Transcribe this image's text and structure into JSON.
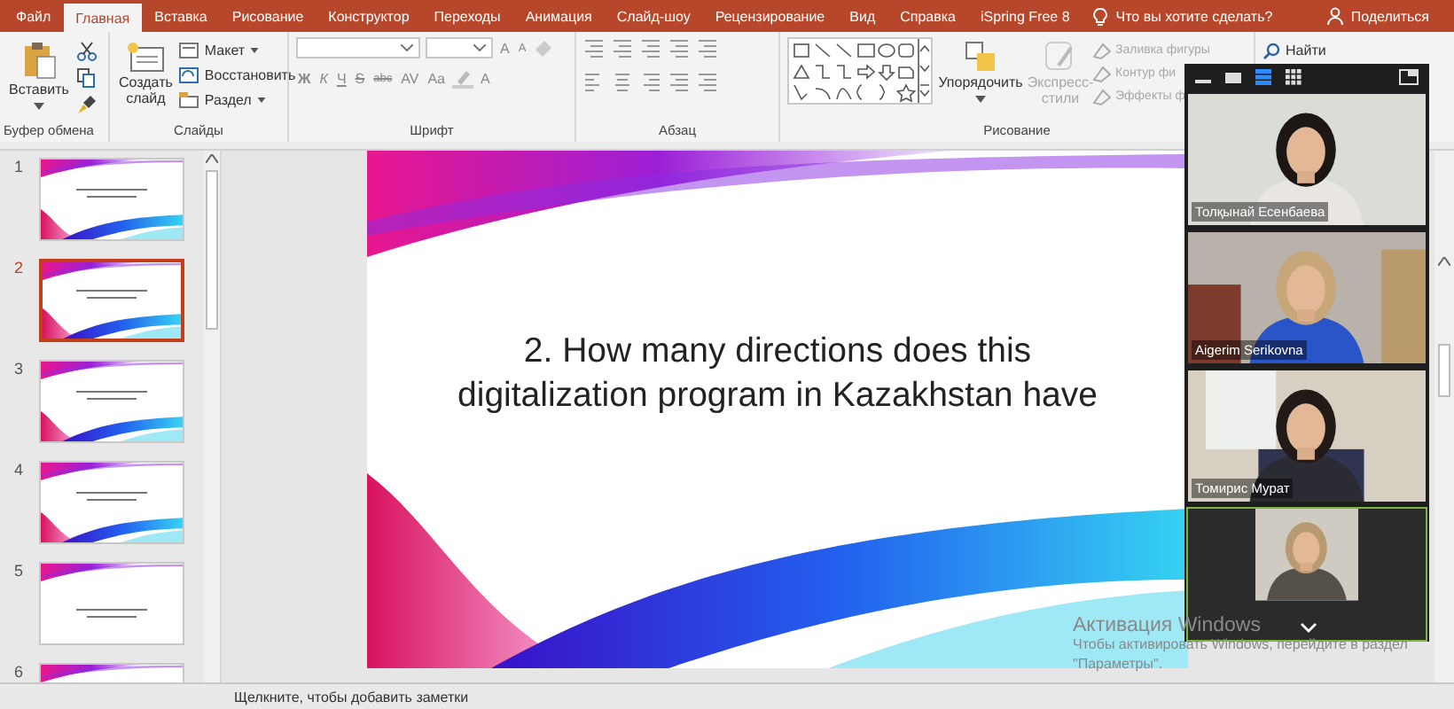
{
  "ribbon_tabs": [
    {
      "label": "Файл",
      "selected": false
    },
    {
      "label": "Главная",
      "selected": true
    },
    {
      "label": "Вставка",
      "selected": false
    },
    {
      "label": "Рисование",
      "selected": false
    },
    {
      "label": "Конструктор",
      "selected": false
    },
    {
      "label": "Переходы",
      "selected": false
    },
    {
      "label": "Анимация",
      "selected": false
    },
    {
      "label": "Слайд-шоу",
      "selected": false
    },
    {
      "label": "Рецензирование",
      "selected": false
    },
    {
      "label": "Вид",
      "selected": false
    },
    {
      "label": "Справка",
      "selected": false
    },
    {
      "label": "iSpring Free 8",
      "selected": false
    }
  ],
  "tell_me": "Что вы хотите сделать?",
  "share": "Поделиться",
  "clipboard": {
    "paste": "Вставить",
    "label": "Буфер обмена"
  },
  "slides_group": {
    "new_slide": "Создать слайд",
    "layout": "Макет",
    "reset": "Восстановить",
    "section": "Раздел",
    "label": "Слайды"
  },
  "font_group": {
    "grow_buttons": [
      "A",
      "A"
    ],
    "format_buttons": [
      "Ж",
      "К",
      "Ч",
      "S",
      "abc",
      "AV",
      "Aa"
    ],
    "color_button": "A",
    "label": "Шрифт"
  },
  "paragraph_group": {
    "label": "Абзац"
  },
  "drawing_group": {
    "arrange": {
      "label": "Упорядочить",
      "disabled": false
    },
    "quick_styles": {
      "label": "Экспресс-стили",
      "disabled": true
    },
    "commands": [
      {
        "label": "Заливка фигуры",
        "disabled": true
      },
      {
        "label": "Контур фи",
        "disabled": true
      },
      {
        "label": "Эффекты ф",
        "disabled": true
      }
    ],
    "label": "Рисование"
  },
  "find": "Найти",
  "thumbnails": [
    {
      "number": "1",
      "selected": false,
      "kind": "full"
    },
    {
      "number": "2",
      "selected": true,
      "kind": "full"
    },
    {
      "number": "3",
      "selected": false,
      "kind": "full"
    },
    {
      "number": "4",
      "selected": false,
      "kind": "full"
    },
    {
      "number": "5",
      "selected": false,
      "kind": "top"
    },
    {
      "number": "6",
      "selected": false,
      "kind": "top"
    }
  ],
  "slide": {
    "title_lines": [
      "2.  How many directions does this",
      "digitalization program in Kazakhstan have"
    ]
  },
  "notes": "Щелкните, чтобы добавить заметки",
  "video_panel": {
    "views": [
      {
        "kind": "speaker",
        "selected": true
      },
      {
        "kind": "gallery",
        "selected": false
      }
    ],
    "tiles": [
      {
        "name": "Толқынай Есенбаева",
        "speaking": false,
        "kind": "full"
      },
      {
        "name": "Aigerim Serikovna",
        "speaking": false,
        "kind": "full"
      },
      {
        "name": "Томирис Мурат",
        "speaking": false,
        "kind": "full"
      },
      {
        "speaking": true,
        "kind": "pillar"
      }
    ]
  },
  "activation": {
    "title": "Активация Windows",
    "text": "Чтобы активировать Windows, перейдите в раздел \"Параметры\"."
  }
}
